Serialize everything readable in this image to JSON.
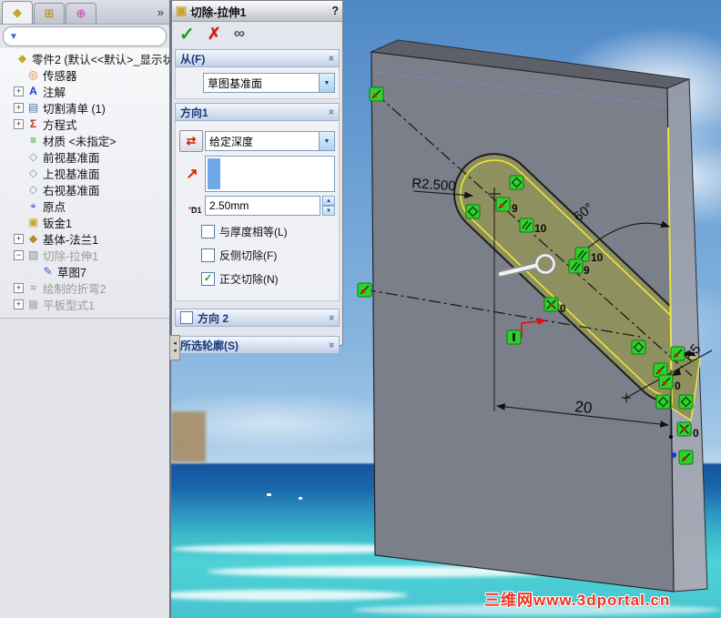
{
  "left_panel": {
    "overflow_chevron": "»",
    "filter_funnel_glyph": "▼",
    "tabs": [
      {
        "name": "featuremanager-tab",
        "glyph": "◆"
      },
      {
        "name": "configuration-tab",
        "glyph": "⊞"
      },
      {
        "name": "dimxpert-tab",
        "glyph": "⊕"
      }
    ],
    "tree": [
      {
        "label": "零件2 (默认<<默认>_显示状态",
        "glyph": "◆",
        "expand": ""
      },
      {
        "label": "传感器",
        "glyph": "◎",
        "expand": ""
      },
      {
        "label": "注解",
        "glyph": "A",
        "expand": "+"
      },
      {
        "label": "切割清单 (1)",
        "glyph": "▤",
        "expand": "+"
      },
      {
        "label": "方程式",
        "glyph": "Σ",
        "expand": "+"
      },
      {
        "label": "材质 <未指定>",
        "glyph": "≡",
        "expand": ""
      },
      {
        "label": "前视基准面",
        "glyph": "◇",
        "expand": ""
      },
      {
        "label": "上视基准面",
        "glyph": "◇",
        "expand": ""
      },
      {
        "label": "右视基准面",
        "glyph": "◇",
        "expand": ""
      },
      {
        "label": "原点",
        "glyph": "⌖",
        "expand": ""
      },
      {
        "label": "钣金1",
        "glyph": "▣",
        "expand": ""
      },
      {
        "label": "基体-法兰1",
        "glyph": "◆",
        "expand": "+"
      },
      {
        "label": "切除-拉伸1",
        "glyph": "▨",
        "expand": "−"
      },
      {
        "label": "草图7",
        "glyph": "✎",
        "expand": ""
      },
      {
        "label": "绘制的折弯2",
        "glyph": "≈",
        "expand": "+"
      },
      {
        "label": "平板型式1",
        "glyph": "▦",
        "expand": "+"
      }
    ]
  },
  "property_manager": {
    "title": "切除-拉伸1",
    "help": "?",
    "title_icon_glyph": "▣",
    "ok_glyph": "✓",
    "cancel_glyph": "✗",
    "preview_glyph": "∞",
    "chevron_glyph": "»",
    "from": {
      "label": "从(F)",
      "value": "草图基准面"
    },
    "direction1": {
      "label": "方向1",
      "reverse_glyph": "⇄",
      "arrow_glyph": "↗",
      "end_condition": "给定深度",
      "d1_label": "D1",
      "d1_arrow_glyph": "↔",
      "depth_value": "2.50mm",
      "spin_up": "▲",
      "spin_down": "▼",
      "checkboxes": [
        {
          "label": "与厚度相等(L)",
          "mark": ""
        },
        {
          "label": "反侧切除(F)",
          "mark": ""
        },
        {
          "label": "正交切除(N)",
          "mark": "✓"
        }
      ]
    },
    "direction2": {
      "label": "方向 2"
    },
    "contours": {
      "label": "所选轮廓(S)"
    }
  },
  "viewport": {
    "dimensions": {
      "slot_radius": "R2.500",
      "angle": "60°",
      "length": "20",
      "corner_radius": "R5"
    },
    "relation_labels": [
      "9",
      "10",
      "10",
      "9",
      "0",
      "0",
      "0"
    ],
    "watermark": "三维网www.3dportal.cn",
    "colors": {
      "plate_front": "#7b7f89",
      "plate_top": "#5d6068",
      "plate_side": "#9ba0ad",
      "slot_fill": "#8e905f",
      "highlight_yellow": "#eae73e",
      "relation_green": "#2fd12f",
      "sky": "#6ba0d4",
      "ocean": "#2c95c0"
    }
  }
}
